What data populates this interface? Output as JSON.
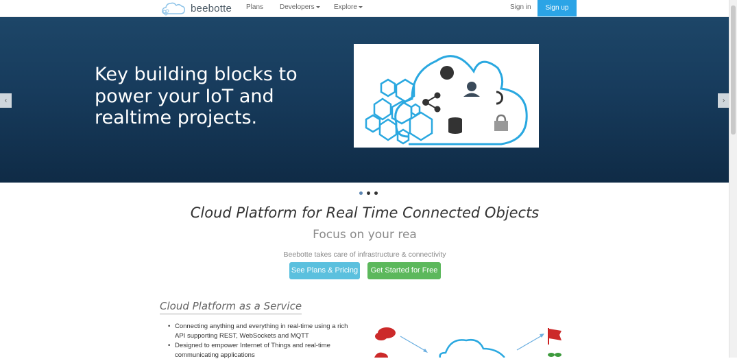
{
  "nav": {
    "brand": "beebotte",
    "items": [
      {
        "label": "Plans"
      },
      {
        "label": "Developers"
      },
      {
        "label": "Explore"
      }
    ],
    "signin": "Sign in",
    "signup": "Sign up"
  },
  "hero": {
    "headline": "Key building blocks to power your IoT and realtime projects.",
    "prev_label": "‹",
    "next_label": "›"
  },
  "main": {
    "title": "Cloud Platform for Real Time Connected Objects",
    "subtitle": "Focus on your rea",
    "tagline": "Beebotte takes care of infrastructure & connectivity",
    "btn_plans": "See Plans & Pricing",
    "btn_start": "Get Started for Free"
  },
  "section": {
    "title": "Cloud Platform as a Service",
    "features": [
      "Connecting anything and everything in real-time using a rich API supporting REST, WebSockets and MQTT",
      "Designed to empower Internet of Things and real-time communicating applications"
    ]
  },
  "colors": {
    "accent": "#2ba4e6",
    "hero_bg": "#173b5c",
    "btn_info": "#5bc0de",
    "btn_success": "#5cb85c"
  }
}
